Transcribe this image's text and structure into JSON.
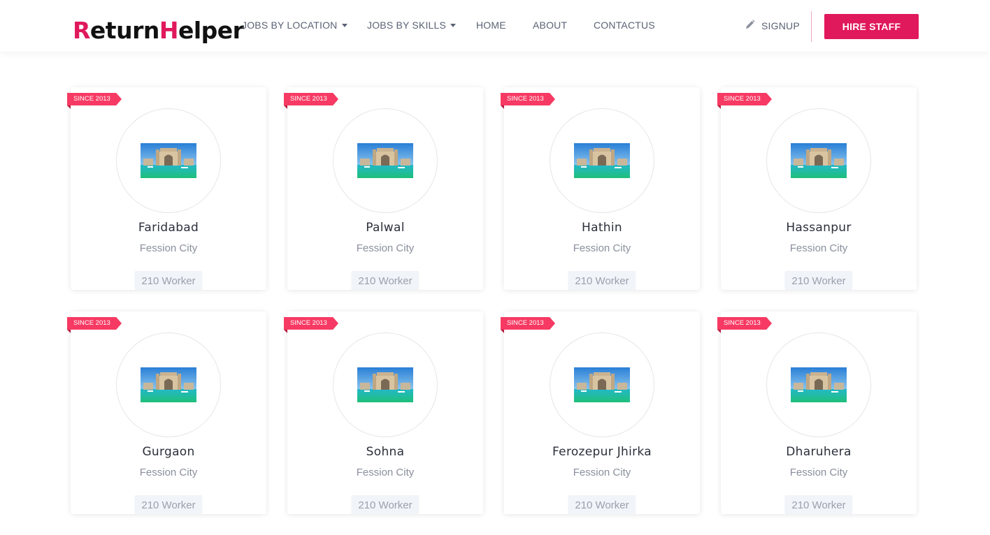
{
  "header": {
    "logo_alt": "ReturnHelper",
    "nav": [
      {
        "label": "JOBS BY LOCATION",
        "dropdown": true
      },
      {
        "label": "JOBS BY SKILLS",
        "dropdown": true
      },
      {
        "label": "HOME",
        "dropdown": false
      },
      {
        "label": "ABOUT",
        "dropdown": false
      },
      {
        "label": "CONTACTUS",
        "dropdown": false
      }
    ],
    "signup_label": "SIGNUP",
    "hire_label": "HIRE STAFF"
  },
  "colors": {
    "accent": "#e0185c",
    "ribbon": "#f73a63",
    "nav_text": "#5b6275"
  },
  "cards": [
    {
      "badge": "SINCE 2013",
      "name": "Faridabad",
      "subtitle": "Fession City",
      "workers": "210 Worker"
    },
    {
      "badge": "SINCE 2013",
      "name": "Palwal",
      "subtitle": "Fession City",
      "workers": "210 Worker"
    },
    {
      "badge": "SINCE 2013",
      "name": "Hathin",
      "subtitle": "Fession City",
      "workers": "210 Worker"
    },
    {
      "badge": "SINCE 2013",
      "name": "Hassanpur",
      "subtitle": "Fession City",
      "workers": "210 Worker"
    },
    {
      "badge": "SINCE 2013",
      "name": "Gurgaon",
      "subtitle": "Fession City",
      "workers": "210 Worker"
    },
    {
      "badge": "SINCE 2013",
      "name": "Sohna",
      "subtitle": "Fession City",
      "workers": "210 Worker"
    },
    {
      "badge": "SINCE 2013",
      "name": "Ferozepur Jhirka",
      "subtitle": "Fession City",
      "workers": "210 Worker"
    },
    {
      "badge": "SINCE 2013",
      "name": "Dharuhera",
      "subtitle": "Fession City",
      "workers": "210 Worker"
    }
  ]
}
